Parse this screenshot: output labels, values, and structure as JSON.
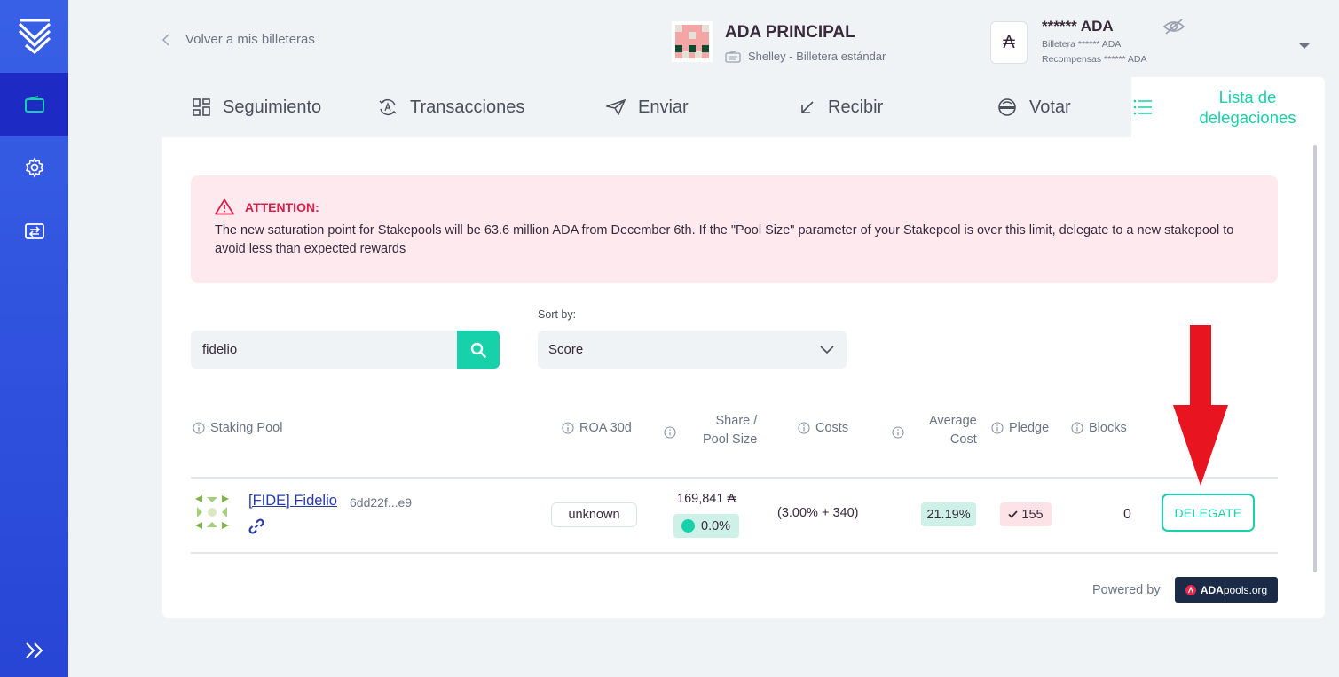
{
  "header": {
    "back_label": "Volver a mis billeteras",
    "wallet_name": "ADA PRINCIPAL",
    "wallet_type": "Shelley - Billetera estándar",
    "balance_main": "****** ADA",
    "balance_wallet": "Billetera ****** ADA",
    "balance_rewards": "Recompensas ****** ADA",
    "ada_symbol": "₳"
  },
  "tabs": [
    {
      "label": "Seguimiento",
      "icon": "dashboard-icon"
    },
    {
      "label": "Transacciones",
      "icon": "transactions-icon"
    },
    {
      "label": "Enviar",
      "icon": "send-icon"
    },
    {
      "label": "Recibir",
      "icon": "receive-icon"
    },
    {
      "label": "Votar",
      "icon": "vote-icon"
    },
    {
      "label": "Lista de delegaciones",
      "icon": "list-icon",
      "active": true
    }
  ],
  "alert": {
    "title": "ATTENTION:",
    "body": "The new saturation point for Stakepools will be 63.6 million ADA from December 6th. If the \"Pool Size\" parameter of your Stakepool is over this limit, delegate to a new stakepool to avoid less than expected rewards"
  },
  "search": {
    "value": "fidelio"
  },
  "sort": {
    "label": "Sort by:",
    "selected": "Score"
  },
  "table": {
    "headers": {
      "pool": "Staking Pool",
      "roa": "ROA 30d",
      "share_line1": "Share /",
      "share_line2": "Pool Size",
      "costs": "Costs",
      "avg_line1": "Average",
      "avg_line2": "Cost",
      "pledge": "Pledge",
      "blocks": "Blocks"
    },
    "rows": [
      {
        "name": "[FIDE] Fidelio",
        "id": "6dd22f...e9",
        "roa": "unknown",
        "share": "169,841 ₳",
        "pool_size_pct": "0.0%",
        "costs": "(3.00% + 340)",
        "average_cost": "21.19%",
        "pledge": "155",
        "blocks": "0",
        "action": "DELEGATE"
      }
    ]
  },
  "footer": {
    "powered_by": "Powered by",
    "brand_bold": "ADA",
    "brand_rest": "pools.org"
  },
  "colors": {
    "accent": "#17d1aa",
    "sidebar": "#3154e0",
    "alert_bg": "#fde9ee",
    "alert_text": "#d81f4a",
    "annotation_arrow": "#e8141f"
  }
}
